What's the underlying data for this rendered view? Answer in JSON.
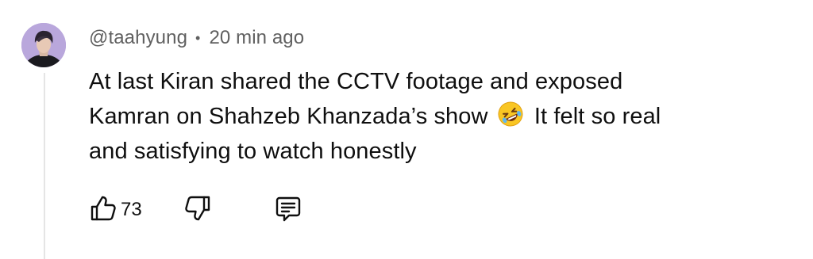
{
  "comment": {
    "author_handle": "@taahyung",
    "separator": "•",
    "timestamp": "20 min ago",
    "text_line1": "At last Kiran shared the CCTV footage and exposed",
    "text_line2_before_emoji": "Kamran on Shahzeb Khanzada’s show",
    "emoji_name": "rolling-on-floor-laughing-emoji",
    "text_line2_after_emoji": "It felt so real",
    "text_line3": "and satisfying to watch honestly"
  },
  "actions": {
    "like_icon": "thumbs-up-icon",
    "like_count": "73",
    "dislike_icon": "thumbs-down-icon",
    "reply_icon": "reply-comment-icon"
  },
  "colors": {
    "text_primary": "#0f0f0f",
    "text_secondary": "#606060",
    "thread_line": "#e5e5e5"
  }
}
